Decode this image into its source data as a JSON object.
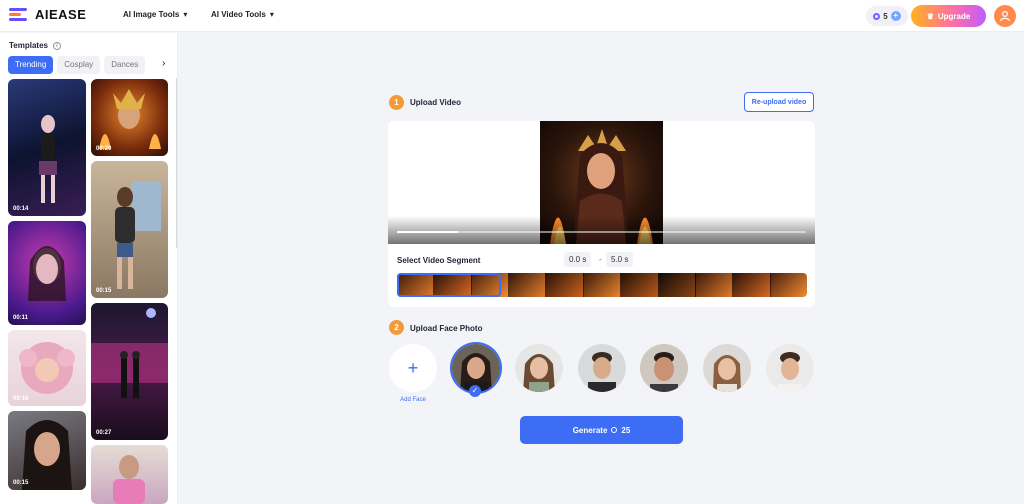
{
  "header": {
    "logo_text": "AIEASE",
    "nav": [
      {
        "label": "AI Image Tools"
      },
      {
        "label": "AI Video Tools"
      }
    ],
    "credits": "5",
    "upgrade_label": "Upgrade"
  },
  "sidebar": {
    "title": "Templates",
    "tabs": [
      "Trending",
      "Cosplay",
      "Dances"
    ],
    "active_tab": "Trending",
    "thumbnails": [
      {
        "duration": "00:14"
      },
      {
        "duration": "00:20"
      },
      {
        "duration": "00:15"
      },
      {
        "duration": "00:11"
      },
      {
        "duration": "00:27"
      },
      {
        "duration": "00:16"
      },
      {
        "duration": "00:15"
      },
      {
        "duration": ""
      }
    ]
  },
  "step1": {
    "number": "1",
    "title": "Upload Video",
    "reupload_label": "Re-upload video",
    "playback_progress": 0.15,
    "segment_label": "Select Video Segment",
    "start": "0.0 s",
    "separator": "-",
    "end": "5.0 s"
  },
  "step2": {
    "number": "2",
    "title": "Upload Face Photo",
    "add_face_label": "Add Face",
    "faces_count": 6,
    "selected_face": 0
  },
  "generate": {
    "label": "Generate",
    "cost": "25"
  },
  "colors": {
    "accent": "#3d6cf5",
    "step_badge": "#f39a3a"
  }
}
